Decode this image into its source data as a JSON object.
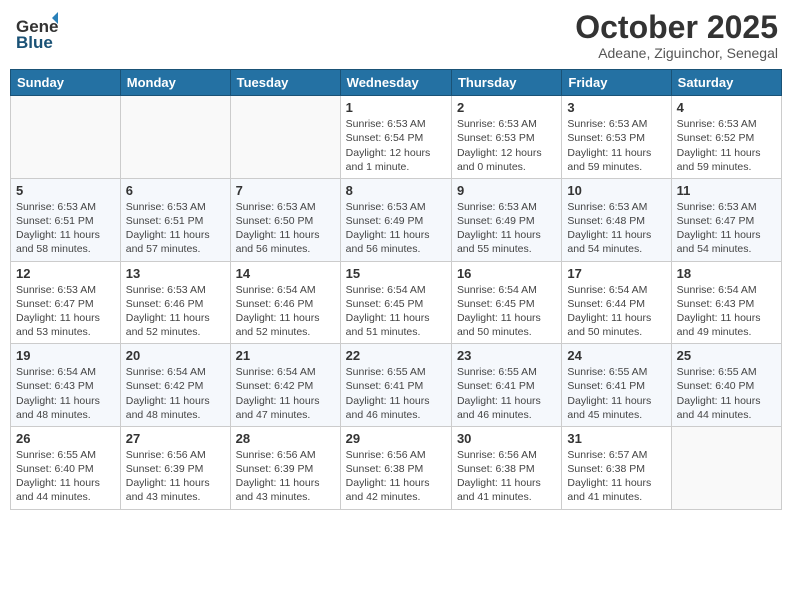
{
  "header": {
    "logo_general": "General",
    "logo_blue": "Blue",
    "month_title": "October 2025",
    "subtitle": "Adeane, Ziguinchor, Senegal"
  },
  "weekdays": [
    "Sunday",
    "Monday",
    "Tuesday",
    "Wednesday",
    "Thursday",
    "Friday",
    "Saturday"
  ],
  "weeks": [
    [
      {
        "day": "",
        "info": ""
      },
      {
        "day": "",
        "info": ""
      },
      {
        "day": "",
        "info": ""
      },
      {
        "day": "1",
        "info": "Sunrise: 6:53 AM\nSunset: 6:54 PM\nDaylight: 12 hours\nand 1 minute."
      },
      {
        "day": "2",
        "info": "Sunrise: 6:53 AM\nSunset: 6:53 PM\nDaylight: 12 hours\nand 0 minutes."
      },
      {
        "day": "3",
        "info": "Sunrise: 6:53 AM\nSunset: 6:53 PM\nDaylight: 11 hours\nand 59 minutes."
      },
      {
        "day": "4",
        "info": "Sunrise: 6:53 AM\nSunset: 6:52 PM\nDaylight: 11 hours\nand 59 minutes."
      }
    ],
    [
      {
        "day": "5",
        "info": "Sunrise: 6:53 AM\nSunset: 6:51 PM\nDaylight: 11 hours\nand 58 minutes."
      },
      {
        "day": "6",
        "info": "Sunrise: 6:53 AM\nSunset: 6:51 PM\nDaylight: 11 hours\nand 57 minutes."
      },
      {
        "day": "7",
        "info": "Sunrise: 6:53 AM\nSunset: 6:50 PM\nDaylight: 11 hours\nand 56 minutes."
      },
      {
        "day": "8",
        "info": "Sunrise: 6:53 AM\nSunset: 6:49 PM\nDaylight: 11 hours\nand 56 minutes."
      },
      {
        "day": "9",
        "info": "Sunrise: 6:53 AM\nSunset: 6:49 PM\nDaylight: 11 hours\nand 55 minutes."
      },
      {
        "day": "10",
        "info": "Sunrise: 6:53 AM\nSunset: 6:48 PM\nDaylight: 11 hours\nand 54 minutes."
      },
      {
        "day": "11",
        "info": "Sunrise: 6:53 AM\nSunset: 6:47 PM\nDaylight: 11 hours\nand 54 minutes."
      }
    ],
    [
      {
        "day": "12",
        "info": "Sunrise: 6:53 AM\nSunset: 6:47 PM\nDaylight: 11 hours\nand 53 minutes."
      },
      {
        "day": "13",
        "info": "Sunrise: 6:53 AM\nSunset: 6:46 PM\nDaylight: 11 hours\nand 52 minutes."
      },
      {
        "day": "14",
        "info": "Sunrise: 6:54 AM\nSunset: 6:46 PM\nDaylight: 11 hours\nand 52 minutes."
      },
      {
        "day": "15",
        "info": "Sunrise: 6:54 AM\nSunset: 6:45 PM\nDaylight: 11 hours\nand 51 minutes."
      },
      {
        "day": "16",
        "info": "Sunrise: 6:54 AM\nSunset: 6:45 PM\nDaylight: 11 hours\nand 50 minutes."
      },
      {
        "day": "17",
        "info": "Sunrise: 6:54 AM\nSunset: 6:44 PM\nDaylight: 11 hours\nand 50 minutes."
      },
      {
        "day": "18",
        "info": "Sunrise: 6:54 AM\nSunset: 6:43 PM\nDaylight: 11 hours\nand 49 minutes."
      }
    ],
    [
      {
        "day": "19",
        "info": "Sunrise: 6:54 AM\nSunset: 6:43 PM\nDaylight: 11 hours\nand 48 minutes."
      },
      {
        "day": "20",
        "info": "Sunrise: 6:54 AM\nSunset: 6:42 PM\nDaylight: 11 hours\nand 48 minutes."
      },
      {
        "day": "21",
        "info": "Sunrise: 6:54 AM\nSunset: 6:42 PM\nDaylight: 11 hours\nand 47 minutes."
      },
      {
        "day": "22",
        "info": "Sunrise: 6:55 AM\nSunset: 6:41 PM\nDaylight: 11 hours\nand 46 minutes."
      },
      {
        "day": "23",
        "info": "Sunrise: 6:55 AM\nSunset: 6:41 PM\nDaylight: 11 hours\nand 46 minutes."
      },
      {
        "day": "24",
        "info": "Sunrise: 6:55 AM\nSunset: 6:41 PM\nDaylight: 11 hours\nand 45 minutes."
      },
      {
        "day": "25",
        "info": "Sunrise: 6:55 AM\nSunset: 6:40 PM\nDaylight: 11 hours\nand 44 minutes."
      }
    ],
    [
      {
        "day": "26",
        "info": "Sunrise: 6:55 AM\nSunset: 6:40 PM\nDaylight: 11 hours\nand 44 minutes."
      },
      {
        "day": "27",
        "info": "Sunrise: 6:56 AM\nSunset: 6:39 PM\nDaylight: 11 hours\nand 43 minutes."
      },
      {
        "day": "28",
        "info": "Sunrise: 6:56 AM\nSunset: 6:39 PM\nDaylight: 11 hours\nand 43 minutes."
      },
      {
        "day": "29",
        "info": "Sunrise: 6:56 AM\nSunset: 6:38 PM\nDaylight: 11 hours\nand 42 minutes."
      },
      {
        "day": "30",
        "info": "Sunrise: 6:56 AM\nSunset: 6:38 PM\nDaylight: 11 hours\nand 41 minutes."
      },
      {
        "day": "31",
        "info": "Sunrise: 6:57 AM\nSunset: 6:38 PM\nDaylight: 11 hours\nand 41 minutes."
      },
      {
        "day": "",
        "info": ""
      }
    ]
  ]
}
